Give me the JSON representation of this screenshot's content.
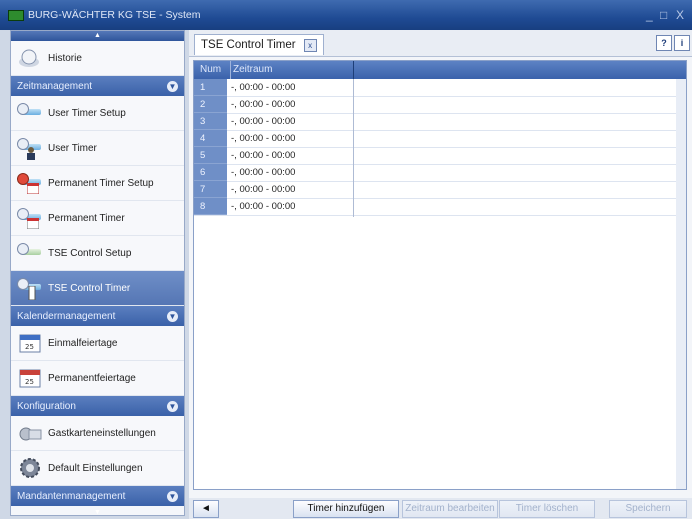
{
  "window": {
    "title": "BURG-WÄCHTER KG TSE - System",
    "controls": {
      "minimize": "_",
      "maximize": "□",
      "close": "X"
    }
  },
  "sidebar": {
    "scroll_up": "▲",
    "scroll_down": "▼",
    "top_item": {
      "label": "Historie",
      "icon": "history-icon"
    },
    "sections": [
      {
        "title": "Zeitmanagement",
        "items": [
          {
            "label": "User Timer Setup",
            "icon": "user-timer-setup-icon"
          },
          {
            "label": "User Timer",
            "icon": "user-timer-icon"
          },
          {
            "label": "Permanent Timer Setup",
            "icon": "permanent-timer-setup-icon"
          },
          {
            "label": "Permanent Timer",
            "icon": "permanent-timer-icon"
          },
          {
            "label": "TSE Control Setup",
            "icon": "tse-control-setup-icon"
          },
          {
            "label": "TSE Control Timer",
            "icon": "tse-control-timer-icon",
            "active": true
          }
        ]
      },
      {
        "title": "Kalendermanagement",
        "items": [
          {
            "label": "Einmalfeiertage",
            "icon": "calendar-icon"
          },
          {
            "label": "Permanentfeiertage",
            "icon": "calendar-icon"
          }
        ]
      },
      {
        "title": "Konfiguration",
        "items": [
          {
            "label": "Gastkarteneinstellungen",
            "icon": "guest-card-icon"
          },
          {
            "label": "Default Einstellungen",
            "icon": "settings-gear-icon"
          }
        ]
      },
      {
        "title": "Mandantenmanagement",
        "items": []
      }
    ]
  },
  "main": {
    "tab": {
      "label": "TSE Control Timer",
      "close": "x"
    },
    "help_label": "?",
    "info_label": "i",
    "grid": {
      "columns": [
        "Num",
        "Zeitraum"
      ],
      "rows": [
        {
          "num": "1",
          "zeitraum": "-, 00:00 - 00:00"
        },
        {
          "num": "2",
          "zeitraum": "-, 00:00 - 00:00"
        },
        {
          "num": "3",
          "zeitraum": "-, 00:00 - 00:00"
        },
        {
          "num": "4",
          "zeitraum": "-, 00:00 - 00:00"
        },
        {
          "num": "5",
          "zeitraum": "-, 00:00 - 00:00"
        },
        {
          "num": "6",
          "zeitraum": "-, 00:00 - 00:00"
        },
        {
          "num": "7",
          "zeitraum": "-, 00:00 - 00:00"
        },
        {
          "num": "8",
          "zeitraum": "-, 00:00 - 00:00"
        }
      ]
    },
    "buttons": {
      "back": "◄",
      "add_timer": "Timer hinzufügen",
      "disabled_1": "Zeitraum bearbeiten",
      "disabled_2": "Timer löschen",
      "disabled_3": "Speichern"
    }
  },
  "colors": {
    "accent": "#3a62ab",
    "active_item": "#5576b4"
  }
}
